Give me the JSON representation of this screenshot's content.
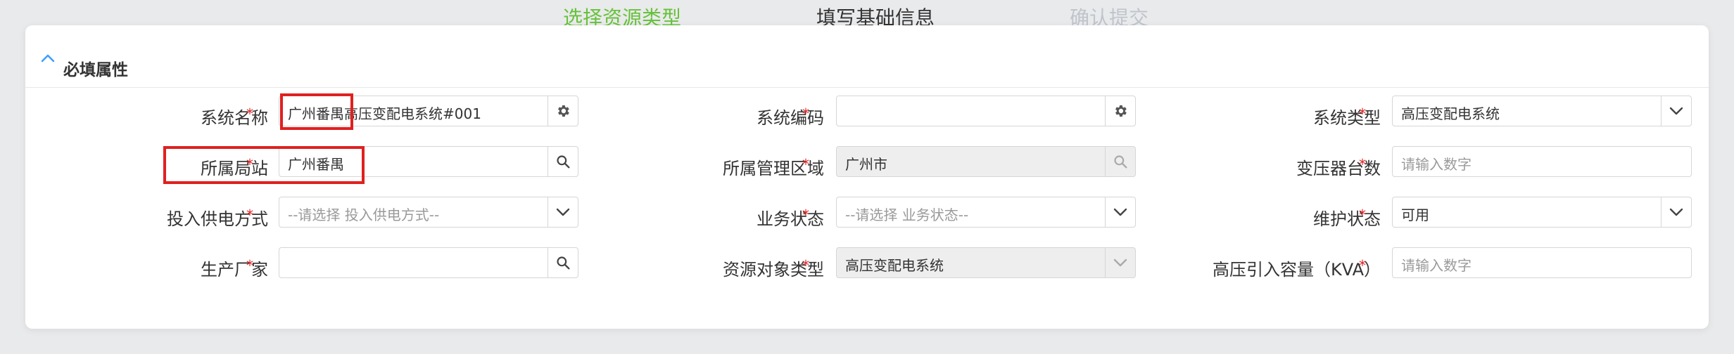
{
  "steps": [
    {
      "label": "选择资源类型",
      "color": "#67c23a"
    },
    {
      "label": "填写基础信息",
      "color": "#333333"
    },
    {
      "label": "确认提交",
      "color": "#c0c4cc"
    }
  ],
  "section": {
    "title": "必填属性"
  },
  "required_mark": "*",
  "fields": {
    "system_name": {
      "label": "系统名称",
      "value": "广州番禺高压变配电系统#001"
    },
    "system_code": {
      "label": "系统编码",
      "value": ""
    },
    "system_type": {
      "label": "系统类型",
      "value": "高压变配电系统"
    },
    "station": {
      "label": "所属局站",
      "value": "广州番禺"
    },
    "mgmt_area": {
      "label": "所属管理区域",
      "value": "广州市"
    },
    "transformer_count": {
      "label": "变压器台数",
      "placeholder": "请输入数字"
    },
    "power_supply_mode": {
      "label": "投入供电方式",
      "placeholder": "--请选择 投入供电方式--"
    },
    "business_status": {
      "label": "业务状态",
      "placeholder": "--请选择 业务状态--"
    },
    "maintenance_status": {
      "label": "维护状态",
      "value": "可用"
    },
    "manufacturer": {
      "label": "生产厂家",
      "value": ""
    },
    "resource_object_type": {
      "label": "资源对象类型",
      "value": "高压变配电系统"
    },
    "hv_capacity": {
      "label": "高压引入容量（KVA）",
      "placeholder": "请输入数字"
    }
  },
  "colors": {
    "accent": "#409eff",
    "required": "#e02020",
    "highlight": "#e02020"
  }
}
